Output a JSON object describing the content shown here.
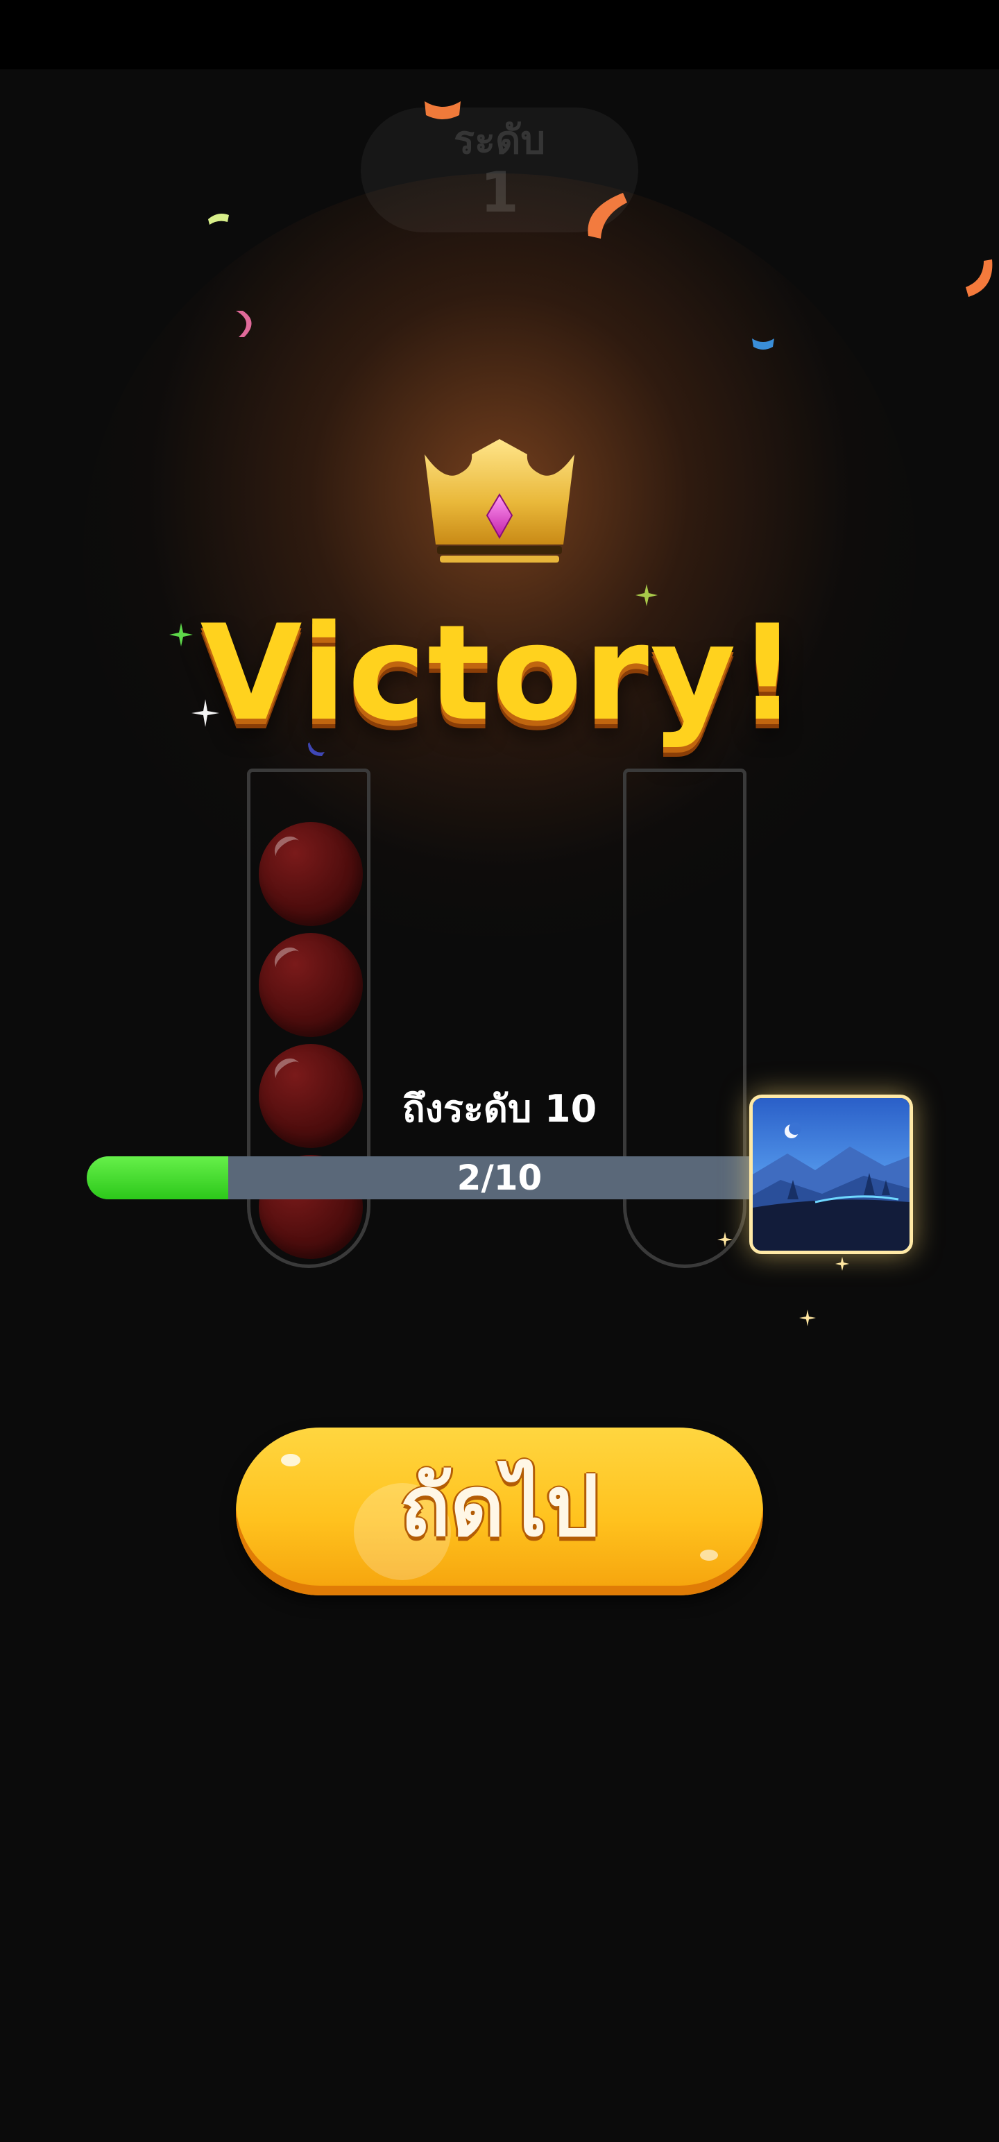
{
  "level": {
    "label": "ระดับ",
    "number": "1"
  },
  "title": "Victory!",
  "progress": {
    "caption": "ถึงระดับ 10",
    "current": 2,
    "target": 10,
    "text": "2/10",
    "fill_fraction": 0.2
  },
  "reward": {
    "icon": "night-landscape-reward-icon"
  },
  "next_button": {
    "label": "ถัดไป"
  },
  "tubes": [
    {
      "balls": 4,
      "ball_color": "#6b1414"
    },
    {
      "balls": 0
    }
  ],
  "colors": {
    "background": "#0b0b0b",
    "accent_gold": "#ffd21e",
    "progress_green": "#3ad824",
    "progress_track": "#5a6879",
    "button_yellow": "#ffc21e"
  }
}
